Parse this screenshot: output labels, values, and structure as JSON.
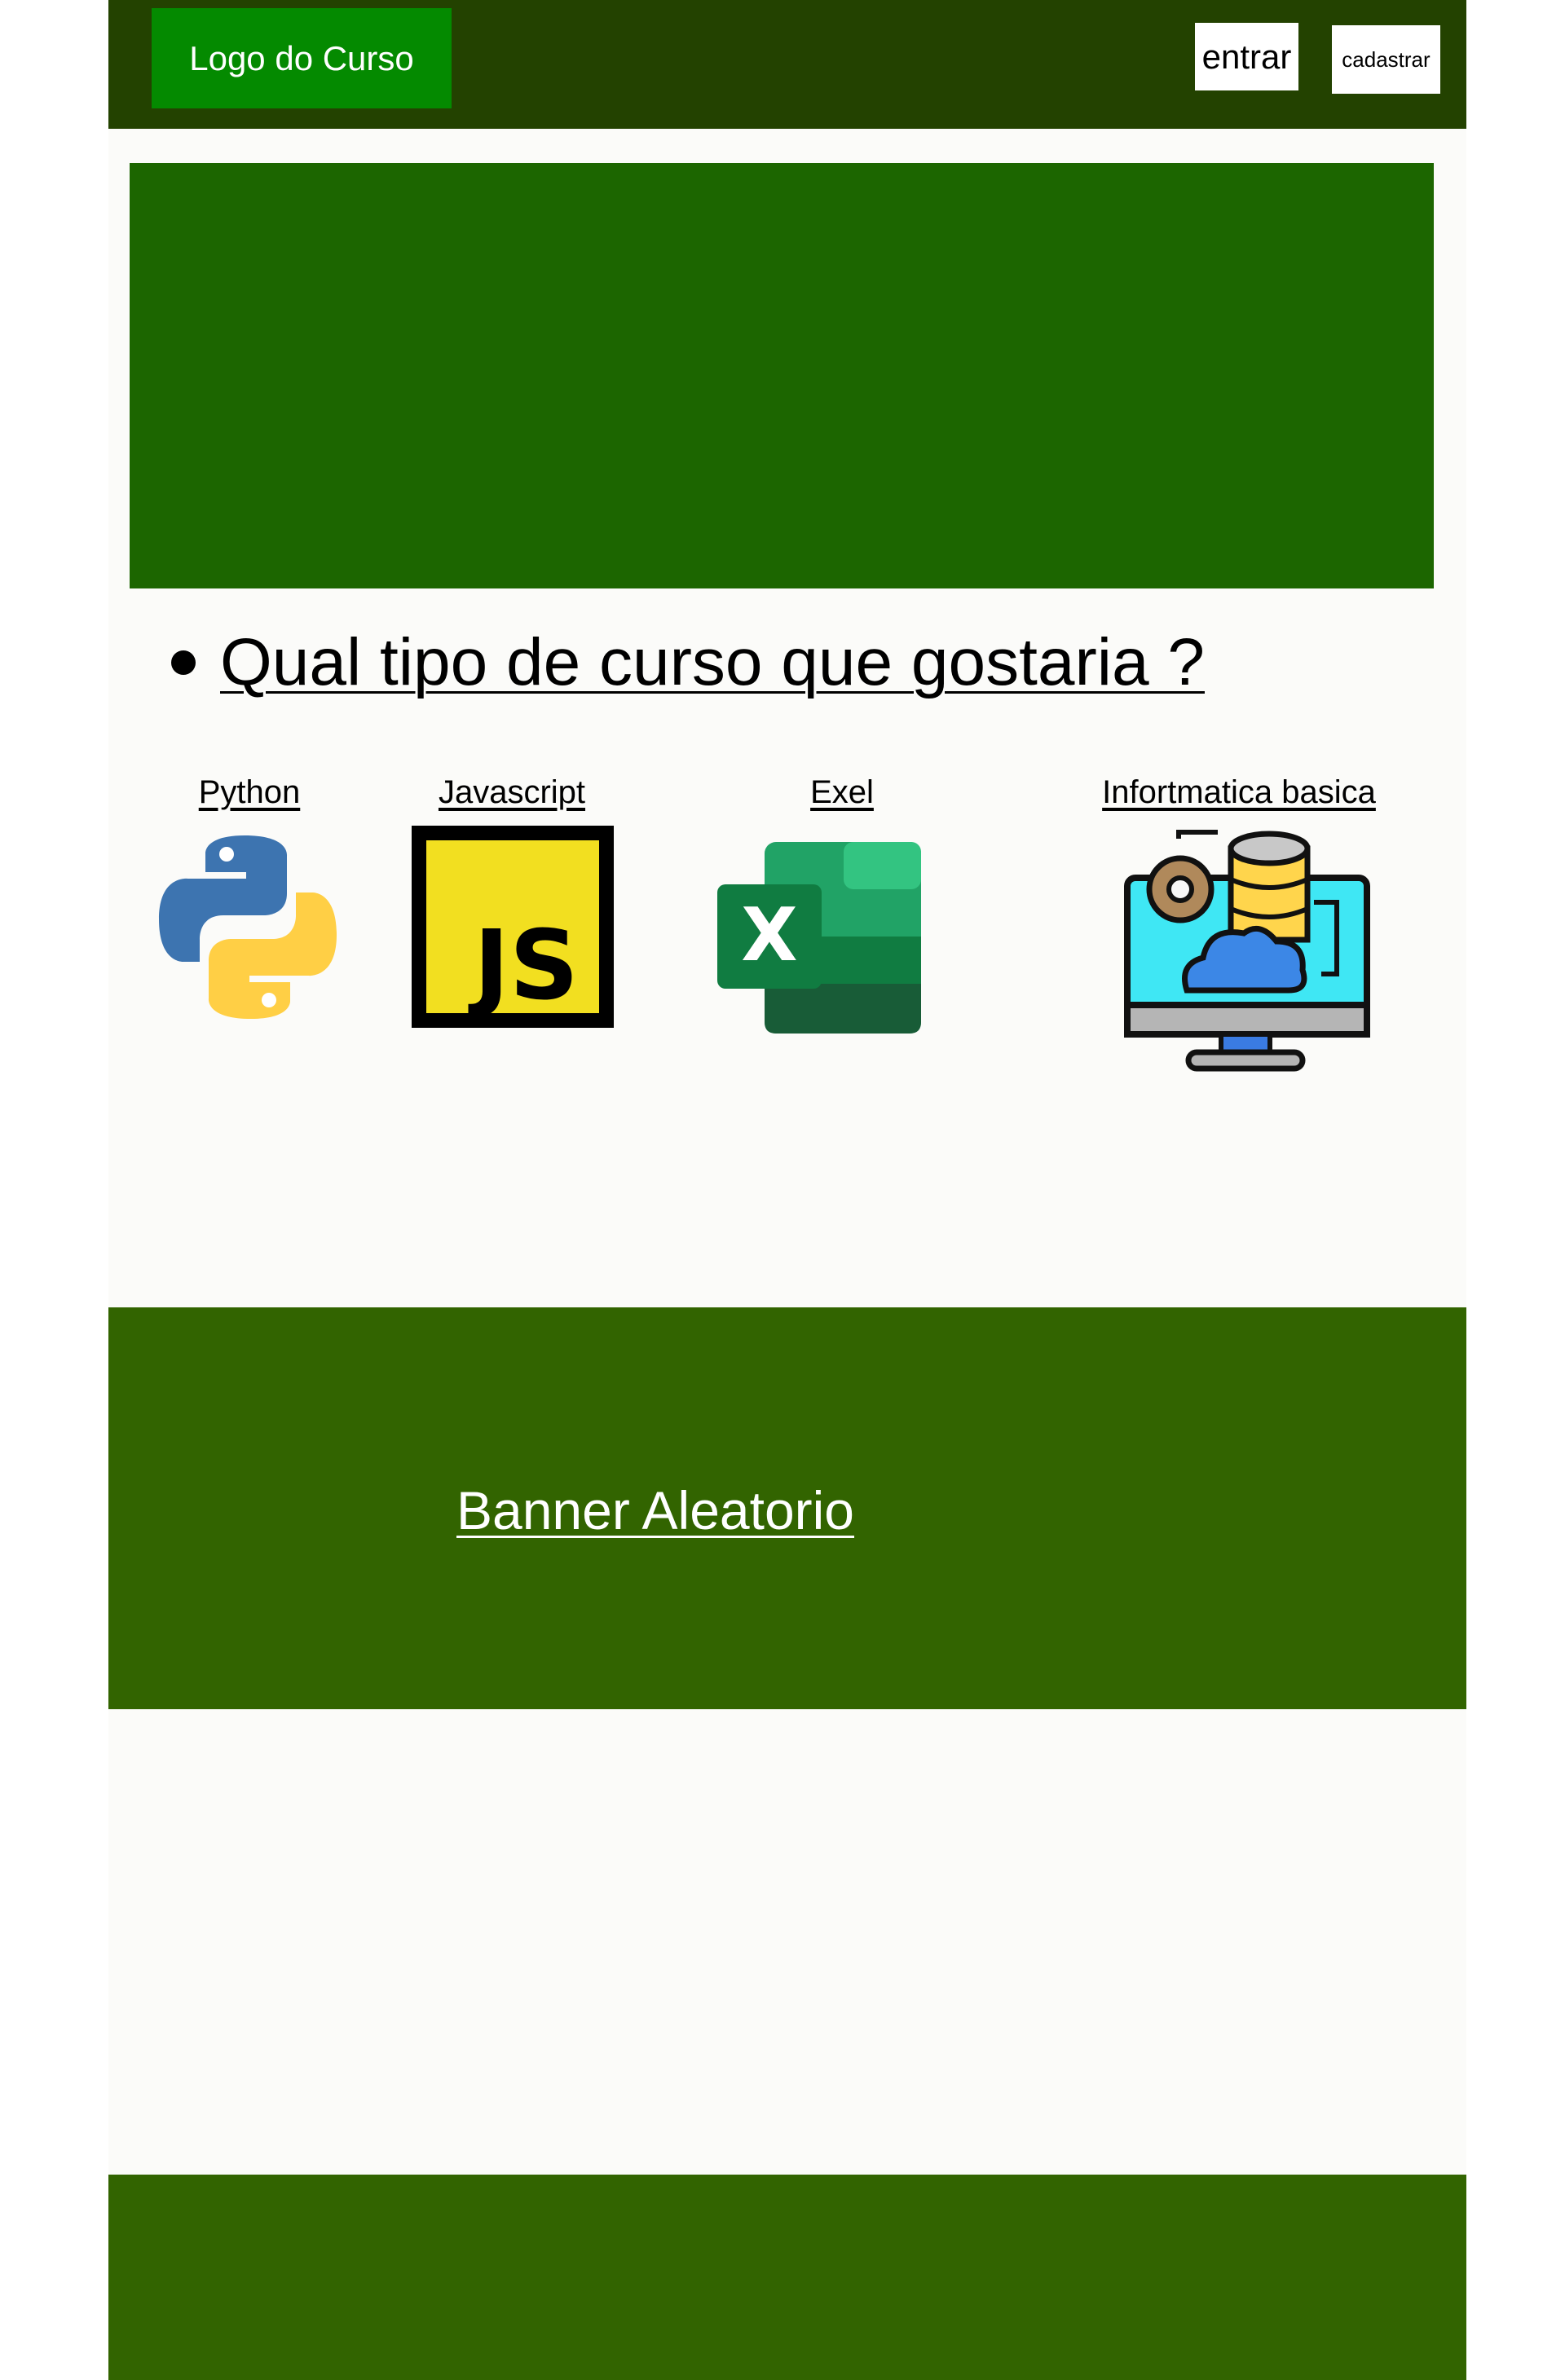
{
  "header": {
    "logo_label": "Logo do Curso",
    "login_label": "entrar",
    "signup_label": "cadastrar"
  },
  "main": {
    "question": "Qual tipo de curso que gostaria ?",
    "courses": [
      {
        "label": "Python",
        "icon": "python-icon"
      },
      {
        "label": "Javascript",
        "icon": "javascript-icon"
      },
      {
        "label": "Exel",
        "icon": "excel-icon"
      },
      {
        "label": "Infortmatica basica",
        "icon": "computer-cloud-database-icon"
      }
    ]
  },
  "banner": {
    "label": "Banner Aleatorio"
  },
  "colors": {
    "header_bg": "#234200",
    "logo_bg": "#048a00",
    "hero_bg": "#1c6600",
    "banner_bg": "#326400",
    "page_bg": "#fbfbf9"
  }
}
